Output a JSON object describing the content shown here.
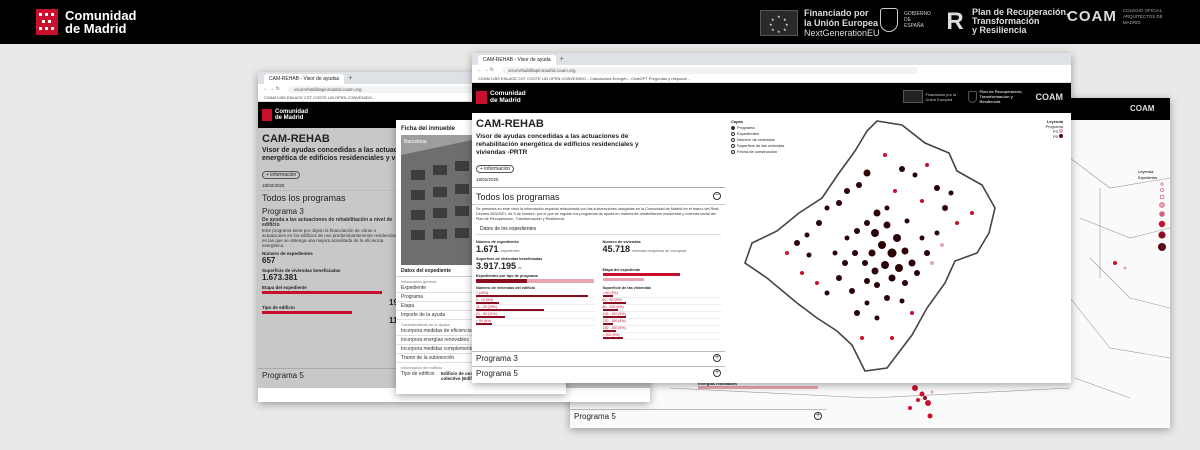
{
  "banner": {
    "cm_line1": "Comunidad",
    "cm_line2": "de Madrid",
    "eu_line1": "Financiado por",
    "eu_line2": "la Unión Europea",
    "eu_line3": "NextGenerationEU",
    "gob_text": "GOBIERNO DE ESPAÑA",
    "prtr_line1": "Plan de Recuperación,",
    "prtr_line2": "Transformación",
    "prtr_line3": "y Resiliencia",
    "coam": "COAM",
    "coam_sub": "Colegio Oficial Arquitectos de Madrid"
  },
  "left_window": {
    "tab": "CAM-REHAB - Visor de ayudas",
    "url": "visorrehabilitapinmadrid.coam.org",
    "bookmarks": "COAM   LIBS ENLACE CST   COSTE LIB   OPEN CONVENIDO...",
    "cm_line1": "Comunidad",
    "cm_line2": "de Madrid",
    "title": "CAM-REHAB",
    "subtitle": "Visor de ayudas concedidas a las actuaciones de rehabilitación energética de edificios residenciales y viviendas -PRTR",
    "info_btn": "+ información",
    "date": "18/02/2025",
    "todos": "Todos los programas",
    "programa3": "Programa 3",
    "prog3_sub": "De ayuda a las actuaciones de rehabilitación a nivel de edificio",
    "prog3_desc": "Este programa tiene por objeto la financiación de obras o actuaciones en los edificios de uso predominantemente residencial en las que se obtenga una mejora acreditada de la eficiencia energética.",
    "stat1_label": "Número de expedientes",
    "stat1_value": "657",
    "stat2_label": "Superficie de viviendas beneficiadas",
    "stat2_value": "1.673.381",
    "stat3_label": "Etapa del expediente",
    "stat4_label": "Tipo de edificio",
    "stat_r1": "19.",
    "stat_r2": "110",
    "programa5": "Programa 5"
  },
  "ficha": {
    "title": "Ficha del inmueble",
    "photo_label": "Barcelona",
    "datos": "Datos del expediente",
    "info_general": "Información general",
    "rows": [
      "Expediente",
      "Programa",
      "Etapa",
      "Importe de la ayuda"
    ],
    "caract": "Características de la ayuda",
    "rows2": [
      "Incorpora medidas de eficiencia",
      "Incorpora energías renovables",
      "Incorpora medidas complementarias",
      "Tramo de la subvención"
    ],
    "info_edif": "Información del edificio",
    "tipo_label": "Tipo de edificio",
    "tipo_value": "Edificio de uso predominantemente residencial colectivo (Edificio)"
  },
  "right_window": {
    "programa5": "Programa 5",
    "leyenda": "Leyenda",
    "expedientes": "Expedientes",
    "energias": "Energías renovables",
    "coam": "COAM"
  },
  "front_window": {
    "tab": "CAM-REHAB - Visor de ayuda",
    "url": "visorrehabilitapinmadrid.coam.org",
    "bookmarks": "COAM   LIBS ENLACE CST   COSTE LIB   OPEN CONVENIDO...   Calculadora Energét...   ChatGPT   Preguntas y respuest...",
    "cm_line1": "Comunidad",
    "cm_line2": "de Madrid",
    "hdr_eu": "Financiado por la Unión Europea",
    "hdr_prtr": "Plan de Recuperación, Transformación y Resiliencia",
    "hdr_coam": "COAM",
    "title": "CAM-REHAB",
    "subtitle": "Visor de ayudas concedidas a las actuaciones de rehabilitación energética de edificios residenciales y viviendas -PRTR",
    "info_btn": "+ información",
    "date": "18/02/2025",
    "todos": "Todos los programas",
    "intro": "Se presenta en este visor la información espacial relacionada con las subvenciones otorgadas en la Comunidad de Madrid en el marco del Real Decreto 853/2021, de 5 de octubre, por el que se regulan los programas de ayuda en materia de rehabilitación residencial y vivienda social del Plan de Recuperación, Transformación y Resiliencia.",
    "datos_label": "Datos de los expedientes",
    "stats": {
      "expedientes_label": "Número de expedientes",
      "expedientes_value": "1.671",
      "expedientes_unit": "expedientes",
      "viviendas_label": "Número de viviendas",
      "viviendas_value": "45.718",
      "viviendas_unit": "viviendas receptoras de una ayuda",
      "superficie_label": "Superficie de viviendas beneficiadas",
      "superficie_value": "3.917.195",
      "superficie_unit": "m²",
      "tipo_label": "Expedientes por tipo de programa",
      "etapa_label": "Etapa del expediente",
      "num_viv_label": "Número de viviendas del edificio",
      "sup_viv_label": "Superficie de las viviendas"
    },
    "bars_left": [
      "1 (43%)",
      "2 - 10 (9%)",
      "11 - 20 (26%)",
      "21 - 50 (11%)",
      "> 50 (6%)"
    ],
    "bars_left_fill": [
      0.43,
      0.09,
      0.26,
      0.11,
      0.06
    ],
    "bars_right": [
      "< 60 (4%)",
      "60 - 80 (9%)",
      "80 - 100 (6%)",
      "100 - 120 (9%)",
      "120 - 150 (4%)",
      "150 - 200 (5%)",
      "> 200 (8%)"
    ],
    "bars_right_fill": [
      0.04,
      0.09,
      0.06,
      0.09,
      0.04,
      0.05,
      0.08
    ],
    "programa3": "Programa 3",
    "programa5": "Programa 5",
    "map": {
      "capas": "Capas",
      "layers": [
        "Programa",
        "Expedientes",
        "Número de viviendas",
        "Superficie de las viviendas",
        "Fecha de construcción"
      ],
      "leyenda": "Leyenda",
      "programa": "Programa",
      "p3": "P3",
      "p5": "P5"
    }
  },
  "colors": {
    "brand_red": "#c8102e",
    "dark_red": "#5a0713",
    "banner_bg": "#000000",
    "page_bg": "#e9e9e7"
  }
}
